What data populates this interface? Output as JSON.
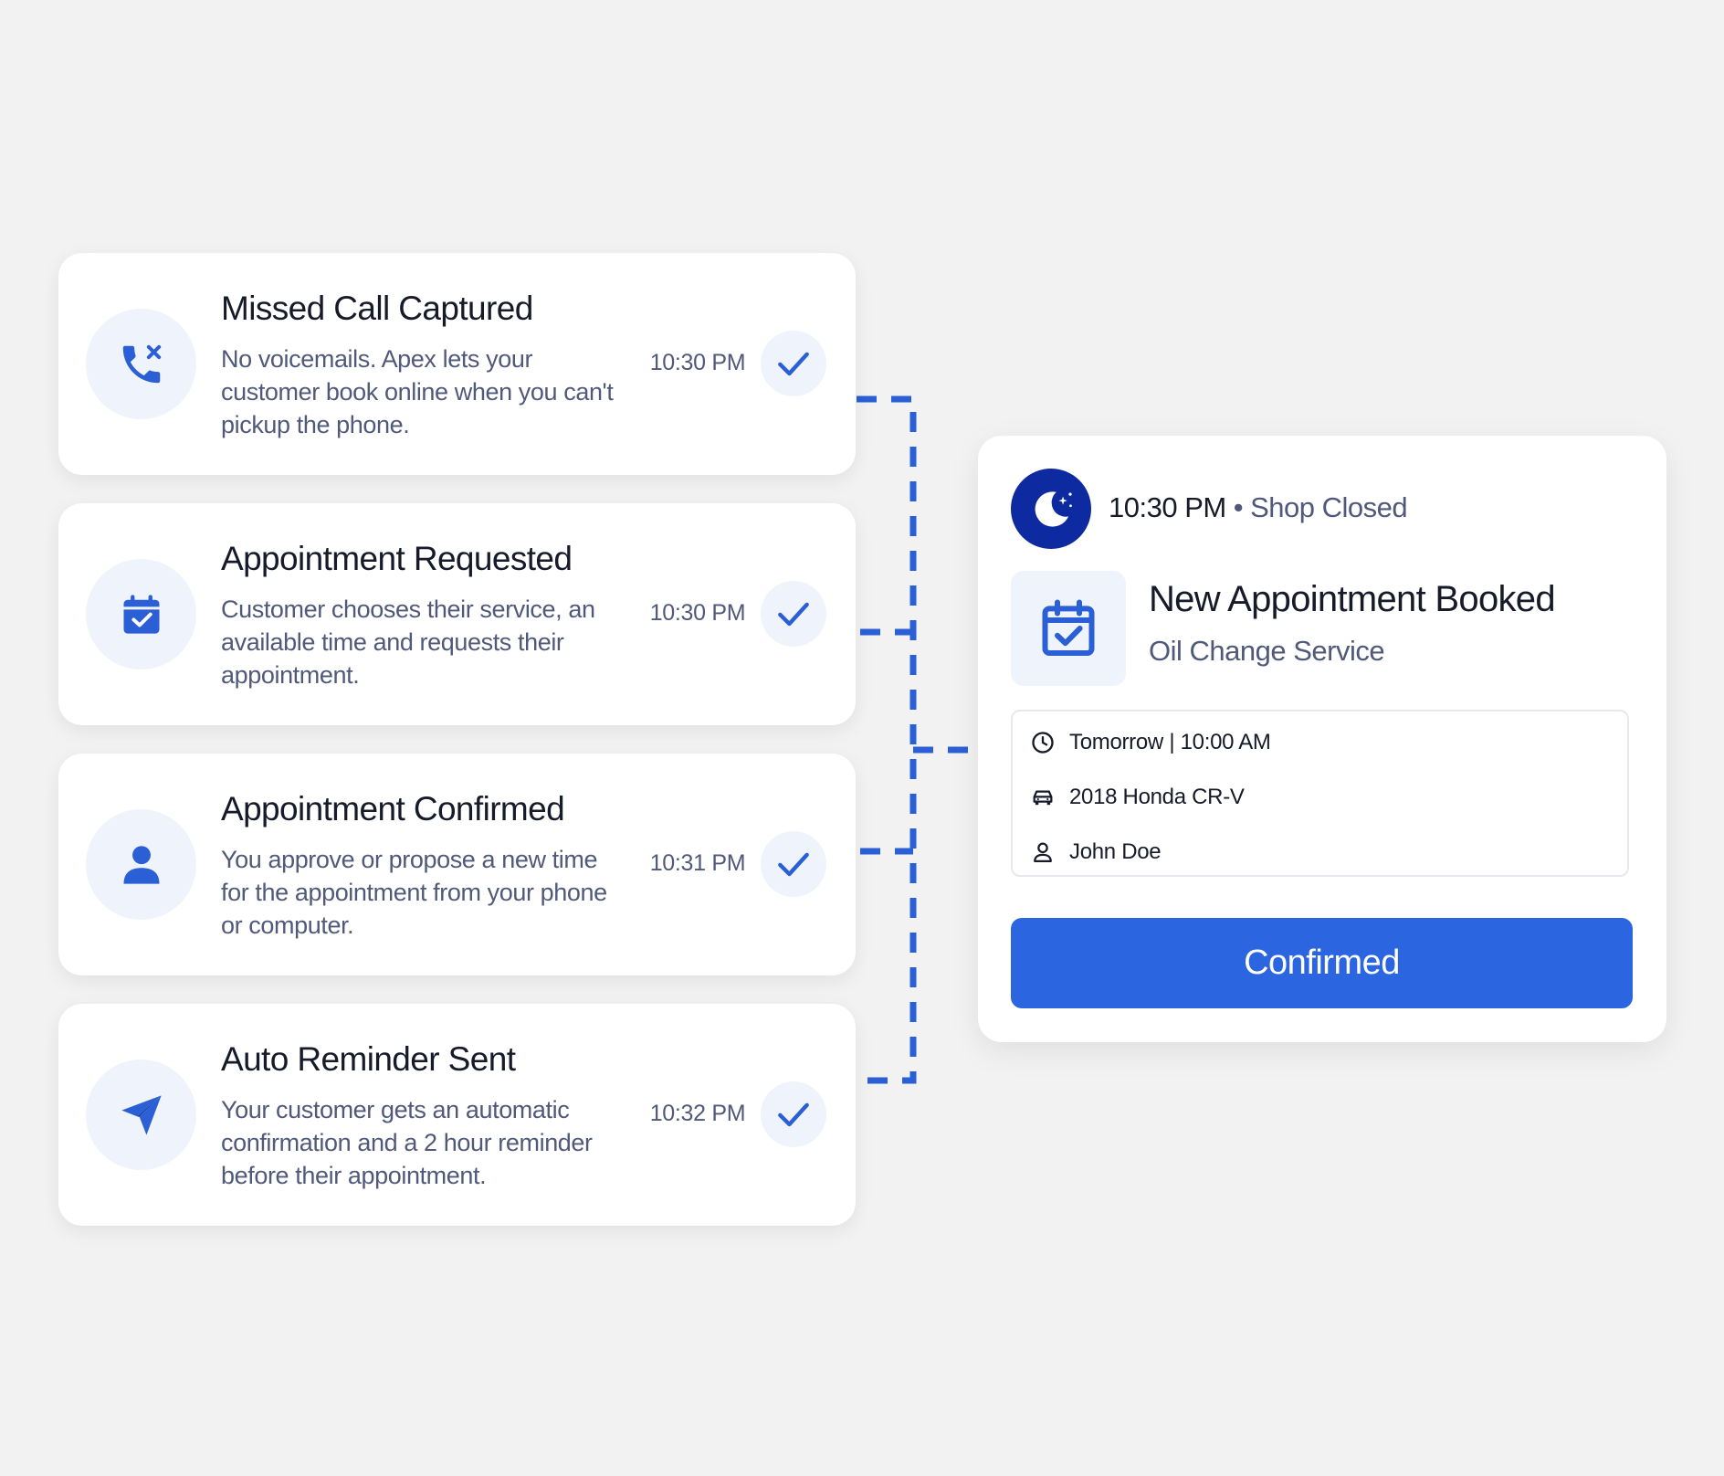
{
  "steps": [
    {
      "title": "Missed Call Captured",
      "description": "No voicemails. Apex lets your customer book online when you can't pickup the phone.",
      "time": "10:30 PM",
      "icon": "phone-missed-icon"
    },
    {
      "title": "Appointment Requested",
      "description": "Customer chooses their service, an available time and requests their appointment.",
      "time": "10:30 PM",
      "icon": "calendar-check-icon"
    },
    {
      "title": "Appointment Confirmed",
      "description": "You approve or propose a new time for the appointment from your phone or computer.",
      "time": "10:31 PM",
      "icon": "user-icon"
    },
    {
      "title": "Auto Reminder Sent",
      "description": "Your customer gets an automatic confirmation and a 2 hour reminder before their appointment.",
      "time": "10:32 PM",
      "icon": "paper-plane-icon"
    }
  ],
  "booking": {
    "time": "10:30 PM",
    "separator": "•",
    "status": "Shop Closed",
    "title": "New Appointment Booked",
    "service": "Oil Change Service",
    "details": [
      {
        "icon": "clock-icon",
        "text": "Tomorrow | 10:00 AM"
      },
      {
        "icon": "car-icon",
        "text": "2018 Honda CR-V"
      },
      {
        "icon": "person-icon",
        "text": "John Doe"
      }
    ],
    "button_label": "Confirmed"
  },
  "colors": {
    "accent": "#2b65e0",
    "icon_blue": "#2a5fd6",
    "navy": "#0d2aa0",
    "background": "#f2f2f2",
    "text_dark": "#161a29",
    "text_muted": "#50597a"
  }
}
